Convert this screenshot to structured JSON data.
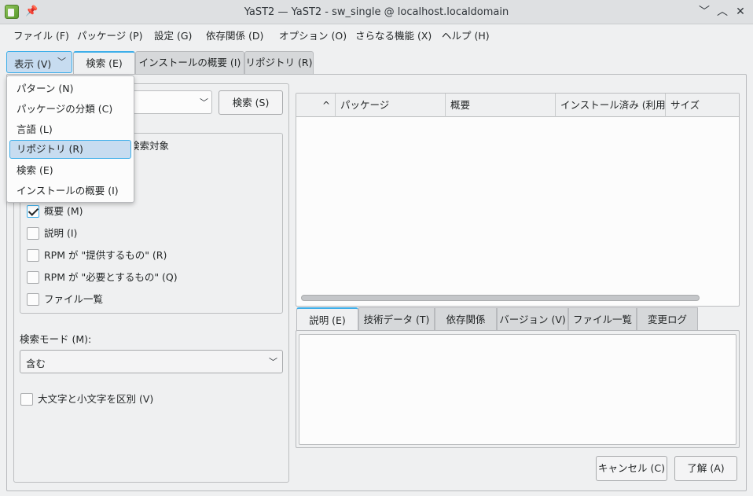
{
  "window": {
    "title": "YaST2 — YaST2 - sw_single @ localhost.localdomain",
    "min_glyph": "﹀",
    "max_glyph": "︿",
    "close_glyph": "✕",
    "pin_glyph": "📌"
  },
  "menubar": [
    "ファイル (F)",
    "パッケージ (P)",
    "設定 (G)",
    "依存関係 (D)",
    "オプション (O)",
    "さらなる機能 (X)",
    "ヘルプ (H)"
  ],
  "top_tabs": {
    "view_dropdown": "表示 (V)",
    "tabs": [
      "検索 (E)",
      "インストールの概要 (I)",
      "リポジトリ (R)"
    ]
  },
  "view_menu": {
    "items": [
      "パターン (N)",
      "パッケージの分類 (C)",
      "言語 (L)",
      "リポジトリ (R)",
      "検索 (E)",
      "インストールの概要 (I)"
    ],
    "selected": "リポジトリ (R)"
  },
  "search": {
    "input_value": "",
    "button_label": "検索 (S)",
    "search_in_title": "検索対象",
    "fields": [
      {
        "label": "概要 (M)",
        "checked": true
      },
      {
        "label": "説明 (I)",
        "checked": false
      },
      {
        "label": "RPM が \"提供するもの\" (R)",
        "checked": false
      },
      {
        "label": "RPM が \"必要とするもの\" (Q)",
        "checked": false
      },
      {
        "label": "ファイル一覧",
        "checked": false
      }
    ],
    "mode_label": "検索モード (M):",
    "mode_value": "含む",
    "case_label": "大文字と小文字を区別 (V)",
    "case_checked": false
  },
  "package_table": {
    "sort_glyph": "^",
    "columns": [
      "パッケージ",
      "概要",
      "インストール済み (利用",
      "サイズ"
    ],
    "rows": []
  },
  "detail_tabs": [
    "説明 (E)",
    "技術データ (T)",
    "依存関係",
    "バージョン (V)",
    "ファイル一覧",
    "変更ログ"
  ],
  "buttons": {
    "cancel": "キャンセル (C)",
    "ok": "了解 (A)"
  },
  "colors": {
    "accent": "#3daee9",
    "selection": "#c7dcf0"
  }
}
